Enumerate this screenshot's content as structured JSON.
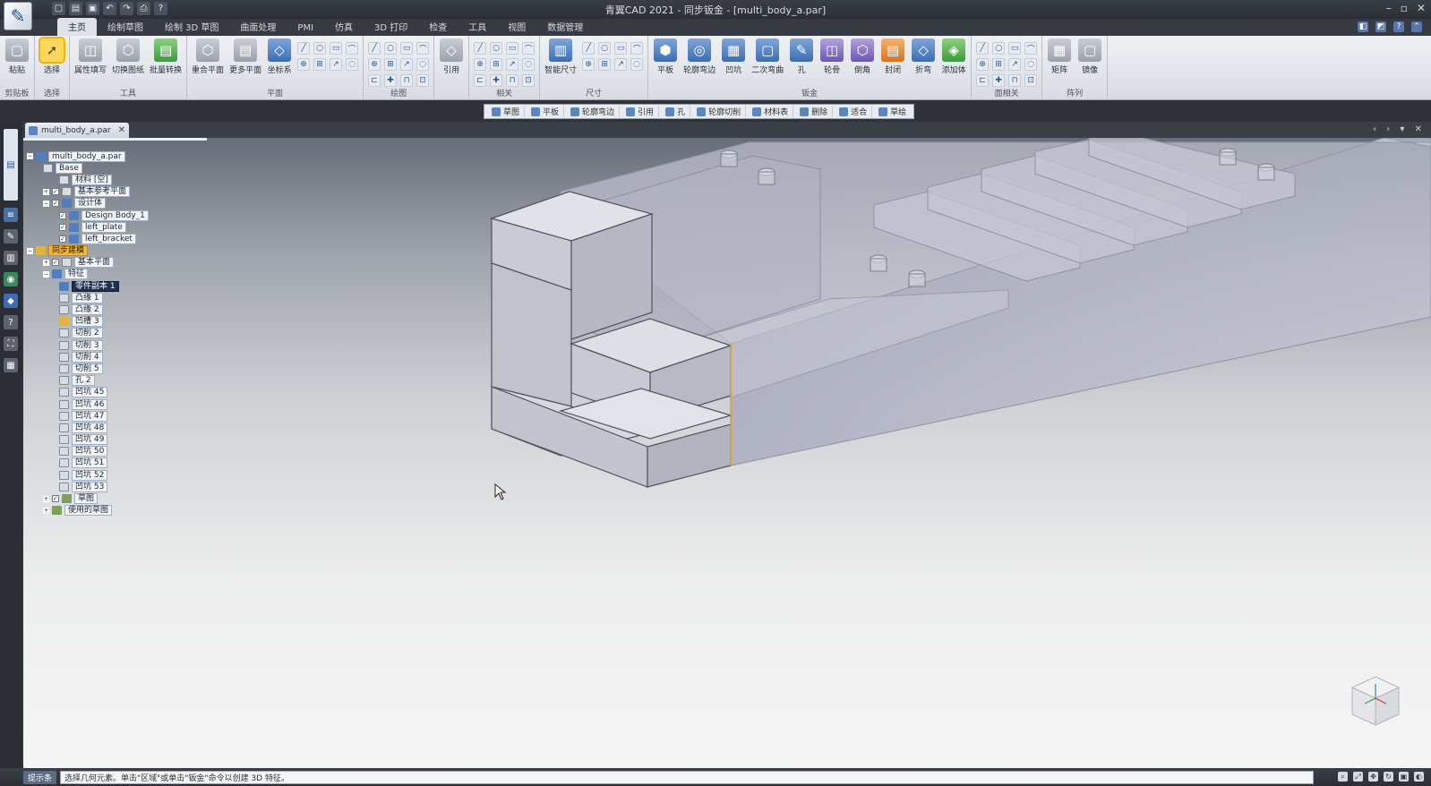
{
  "window": {
    "title": "青翼CAD 2021 - 同步钣金 - [multi_body_a.par]",
    "logo_icon": "pen-logo-icon",
    "quick_access": [
      "new-icon",
      "open-icon",
      "save-icon",
      "undo-icon",
      "redo-icon",
      "print-icon",
      "help-icon"
    ],
    "controls": [
      "minimize-icon",
      "maximize-icon",
      "close-icon"
    ]
  },
  "tabs": [
    {
      "label": "主页",
      "active": true
    },
    {
      "label": "绘制草图"
    },
    {
      "label": "绘制 3D 草图"
    },
    {
      "label": "曲面处理"
    },
    {
      "label": "PMI"
    },
    {
      "label": "仿真"
    },
    {
      "label": "3D 打印"
    },
    {
      "label": "检查"
    },
    {
      "label": "工具"
    },
    {
      "label": "视图"
    },
    {
      "label": "数据管理"
    }
  ],
  "ribbon": {
    "groups": [
      {
        "label": "剪贴板",
        "commands": [
          {
            "label": "粘贴",
            "icon": "paste-icon",
            "color": "gray"
          }
        ]
      },
      {
        "label": "选择",
        "commands": [
          {
            "label": "选择",
            "icon": "select-arrow-icon",
            "color": "selected"
          }
        ]
      },
      {
        "label": "工具",
        "commands": [
          {
            "label": "属性填写",
            "icon": "property-icon",
            "color": "gray"
          },
          {
            "label": "切换图纸",
            "icon": "switch-drawing-icon",
            "color": "gray"
          },
          {
            "label": "批量转换",
            "icon": "batch-convert-icon",
            "color": "green"
          }
        ]
      },
      {
        "label": "平面",
        "commands": [
          {
            "label": "重合平面",
            "icon": "coincident-plane-icon",
            "color": "gray"
          },
          {
            "label": "更多平面",
            "icon": "more-planes-icon",
            "color": "gray"
          },
          {
            "label": "坐标系",
            "icon": "coordinate-system-icon",
            "color": "blue"
          }
        ]
      },
      {
        "label": "绘图",
        "commands": []
      },
      {
        "label": "",
        "commands": [
          {
            "label": "引用",
            "icon": "reference-icon",
            "color": "gray"
          }
        ]
      },
      {
        "label": "相关",
        "commands": []
      },
      {
        "label": "尺寸",
        "commands": [
          {
            "label": "智能尺寸",
            "icon": "smart-dimension-icon",
            "color": "blue"
          }
        ]
      },
      {
        "label": "钣金",
        "commands": [
          {
            "label": "平板",
            "icon": "tab-icon",
            "color": "blue"
          },
          {
            "label": "轮廓弯边",
            "icon": "contour-flange-icon",
            "color": "blue"
          },
          {
            "label": "凹坑",
            "icon": "dimple-icon",
            "color": "blue"
          },
          {
            "label": "二次弯曲",
            "icon": "jog-icon",
            "color": "blue"
          },
          {
            "label": "孔",
            "icon": "hole-icon",
            "color": "blue"
          },
          {
            "label": "轮骨",
            "icon": "rib-icon",
            "color": "purple"
          },
          {
            "label": "倒角",
            "icon": "chamfer-icon",
            "color": "purple"
          },
          {
            "label": "封闭",
            "icon": "close-corner-icon",
            "color": "orange"
          },
          {
            "label": "折弯",
            "icon": "bend-icon",
            "color": "blue"
          },
          {
            "label": "添加体",
            "icon": "add-body-icon",
            "color": "green"
          }
        ]
      },
      {
        "label": "面相关",
        "commands": []
      },
      {
        "label": "阵列",
        "commands": [
          {
            "label": "矩阵",
            "icon": "pattern-icon",
            "color": "gray"
          },
          {
            "label": "镜像",
            "icon": "mirror-icon",
            "color": "gray"
          }
        ]
      }
    ]
  },
  "command_bar": {
    "items": [
      {
        "label": "草图",
        "icon": "sketch-icon"
      },
      {
        "label": "平板",
        "icon": "tab-icon"
      },
      {
        "label": "轮廓弯边",
        "icon": "contour-flange-icon"
      },
      {
        "label": "引用",
        "icon": "reference-icon"
      },
      {
        "label": "孔",
        "icon": "hole-icon"
      },
      {
        "label": "轮廓切削",
        "icon": "cutout-icon"
      },
      {
        "label": "材料表",
        "icon": "material-table-icon"
      },
      {
        "label": "删除",
        "icon": "delete-icon"
      },
      {
        "label": "适合",
        "icon": "fit-icon"
      },
      {
        "label": "草绘",
        "icon": "draw-icon"
      }
    ]
  },
  "document": {
    "tab_label": "multi_body_a.par",
    "close_icon": "close-icon"
  },
  "tree": {
    "nodes": [
      {
        "label": "multi_body_a.par",
        "level": 0,
        "icon": "b",
        "expander": "−"
      },
      {
        "label": "Base",
        "level": 1,
        "icon": "w"
      },
      {
        "label": "材料 [空]",
        "level": 2,
        "icon": "w"
      },
      {
        "label": "基本参考平面",
        "level": 1,
        "icon": "w",
        "expander": "+",
        "check": true
      },
      {
        "label": "设计体",
        "level": 1,
        "icon": "b",
        "expander": "−",
        "check": true
      },
      {
        "label": "Design Body_1",
        "level": 2,
        "icon": "b",
        "check": true
      },
      {
        "label": "left_plate",
        "level": 2,
        "icon": "b",
        "check": true
      },
      {
        "label": "left_bracket",
        "level": 2,
        "icon": "b",
        "check": true
      },
      {
        "label": "同步建模",
        "level": 0,
        "icon": "y",
        "expander": "−",
        "highlight": true
      },
      {
        "label": "基本平面",
        "level": 1,
        "icon": "w",
        "expander": "+",
        "check": true
      },
      {
        "label": "特征",
        "level": 1,
        "icon": "b",
        "expander": "−"
      },
      {
        "label": "零件副本 1",
        "level": 2,
        "icon": "b",
        "dark": true
      },
      {
        "label": "凸缘 1",
        "level": 2,
        "icon": "w"
      },
      {
        "label": "凸缘 2",
        "level": 2,
        "icon": "w"
      },
      {
        "label": "凹槽 3",
        "level": 2,
        "icon": "y"
      },
      {
        "label": "切削 2",
        "level": 2,
        "icon": "w"
      },
      {
        "label": "切削 3",
        "level": 2,
        "icon": "w"
      },
      {
        "label": "切削 4",
        "level": 2,
        "icon": "w"
      },
      {
        "label": "切削 5",
        "level": 2,
        "icon": "w"
      },
      {
        "label": "孔 2",
        "level": 2,
        "icon": "w"
      },
      {
        "label": "凹坑 45",
        "level": 2,
        "icon": "w"
      },
      {
        "label": "凹坑 46",
        "level": 2,
        "icon": "w"
      },
      {
        "label": "凹坑 47",
        "level": 2,
        "icon": "w"
      },
      {
        "label": "凹坑 48",
        "level": 2,
        "icon": "w"
      },
      {
        "label": "凹坑 49",
        "level": 2,
        "icon": "w"
      },
      {
        "label": "凹坑 50",
        "level": 2,
        "icon": "w"
      },
      {
        "label": "凹坑 51",
        "level": 2,
        "icon": "w"
      },
      {
        "label": "凹坑 52",
        "level": 2,
        "icon": "w"
      },
      {
        "label": "凹坑 53",
        "level": 2,
        "icon": "w"
      },
      {
        "label": "草图",
        "level": 1,
        "icon": "g",
        "expander": "+",
        "check": true
      },
      {
        "label": "使用的草图",
        "level": 1,
        "icon": "g",
        "expander": "+"
      }
    ]
  },
  "left_toolbar": [
    "pathfinder-icon",
    "layers-icon",
    "tools-icon",
    "library-icon",
    "sensor-icon",
    "reports-icon",
    "appearance-icon",
    "help-icon",
    "selection-icon",
    "grid-icon"
  ],
  "status": {
    "prompt_label": "提示条",
    "prompt_text": "选择几何元素。单击\"区域\"或单击\"钣金\"命令以创建 3D 特征。",
    "right_icons": [
      "zoom-icon",
      "fit-icon",
      "pan-icon",
      "rotate-icon",
      "view-icon",
      "shade-icon"
    ]
  },
  "colors": {
    "selection_highlight": "#f2b63a",
    "model_face_top": "#dcdde3",
    "model_face_front": "#b9bccb",
    "model_edge": "#5b5f6a"
  }
}
